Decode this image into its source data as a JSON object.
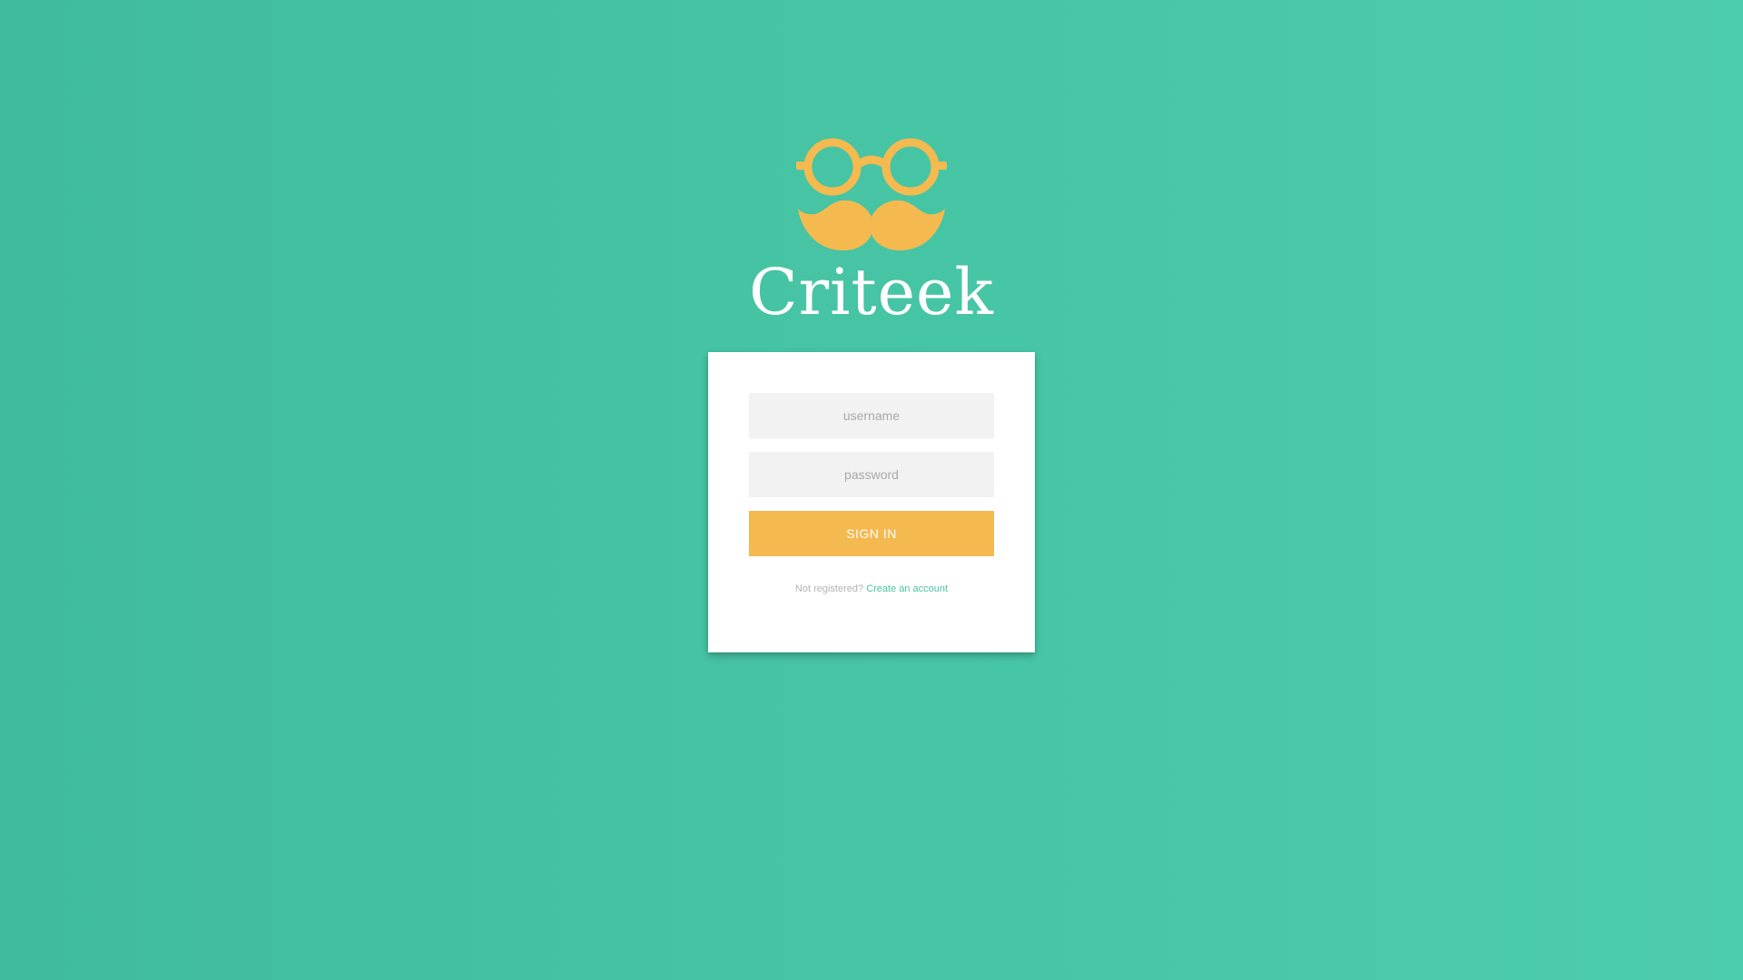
{
  "brand": {
    "name": "Criteek",
    "logo_icon": "glasses-mustache-icon",
    "logo_color": "#f4b94f"
  },
  "login": {
    "username_placeholder": "username",
    "password_placeholder": "password",
    "signin_label": "SIGN IN",
    "register_prompt": "Not registered?",
    "register_link": "Create an account"
  },
  "colors": {
    "background_start": "#40bc9c",
    "background_end": "#4ccdac",
    "accent": "#f4b94f",
    "link": "#4bc3a3",
    "field_bg": "#f2f2f2"
  }
}
